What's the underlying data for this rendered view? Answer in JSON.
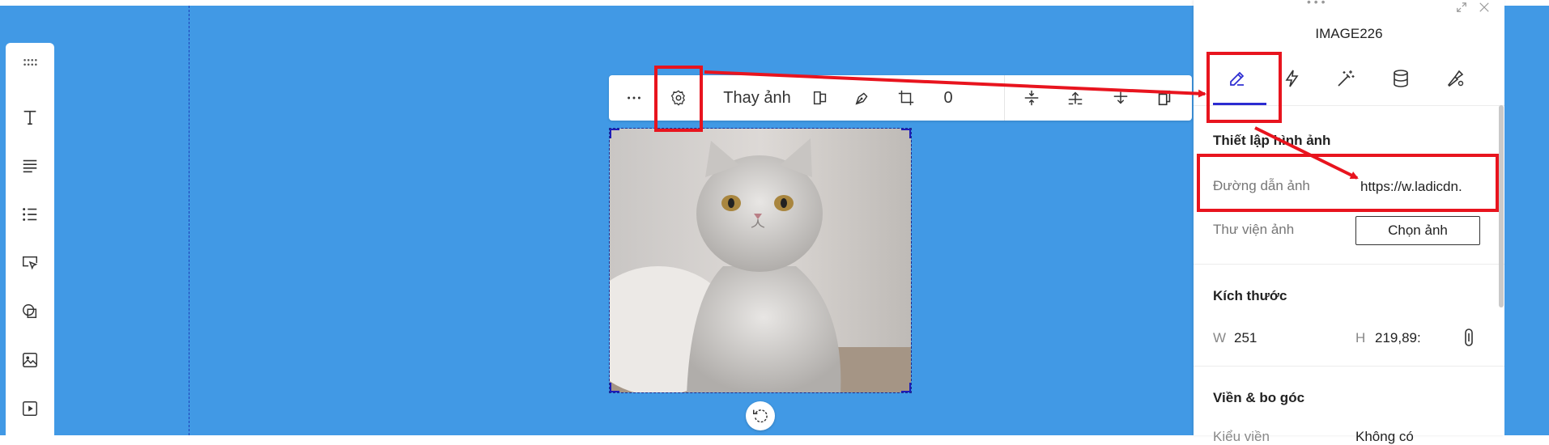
{
  "left_toolbar": {
    "items": [
      {
        "icon": "drag-handle-icon"
      },
      {
        "icon": "text-icon"
      },
      {
        "icon": "paragraph-icon"
      },
      {
        "icon": "list-icon"
      },
      {
        "icon": "button-icon"
      },
      {
        "icon": "shape-icon"
      },
      {
        "icon": "image-icon"
      },
      {
        "icon": "video-icon"
      }
    ]
  },
  "image_toolbar": {
    "replace_label": "Thay ảnh",
    "crop_value": "0"
  },
  "right_panel": {
    "element_title": "IMAGE226",
    "tabs": [
      {
        "icon": "edit-icon",
        "active": true
      },
      {
        "icon": "lightning-icon",
        "active": false
      },
      {
        "icon": "magic-wand-icon",
        "active": false
      },
      {
        "icon": "database-icon",
        "active": false
      },
      {
        "icon": "settings-brush-icon",
        "active": false
      }
    ],
    "image_settings": {
      "heading": "Thiết lập hình ảnh",
      "url_label": "Đường dẫn ảnh",
      "url_value": "https://w.ladicdn.",
      "library_label": "Thư viện ảnh",
      "choose_button": "Chọn ảnh"
    },
    "size": {
      "heading": "Kích thước",
      "w_label": "W",
      "w_value": "251",
      "h_label": "H",
      "h_value": "219,89:"
    },
    "border": {
      "heading": "Viền & bo góc",
      "type_label": "Kiểu viền",
      "type_value": "Không có"
    }
  },
  "colors": {
    "canvas": "#4199e5",
    "accent": "#2b2bd1",
    "annotation": "#e8141e"
  }
}
